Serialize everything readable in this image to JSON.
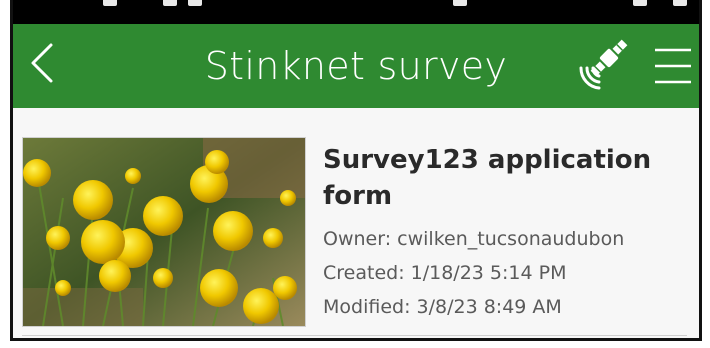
{
  "header": {
    "title": "Stinknet survey",
    "background_color": "#2f8a31",
    "back_icon": "chevron-left-icon",
    "gps_icon": "satellite-icon",
    "menu_icon": "hamburger-menu-icon"
  },
  "survey_item": {
    "title": "Survey123 application form",
    "owner": "Owner: cwilken_tucsonaudubon",
    "created": "Created: 1/18/23 5:14 PM",
    "modified": "Modified: 3/8/23 8:49 AM"
  }
}
